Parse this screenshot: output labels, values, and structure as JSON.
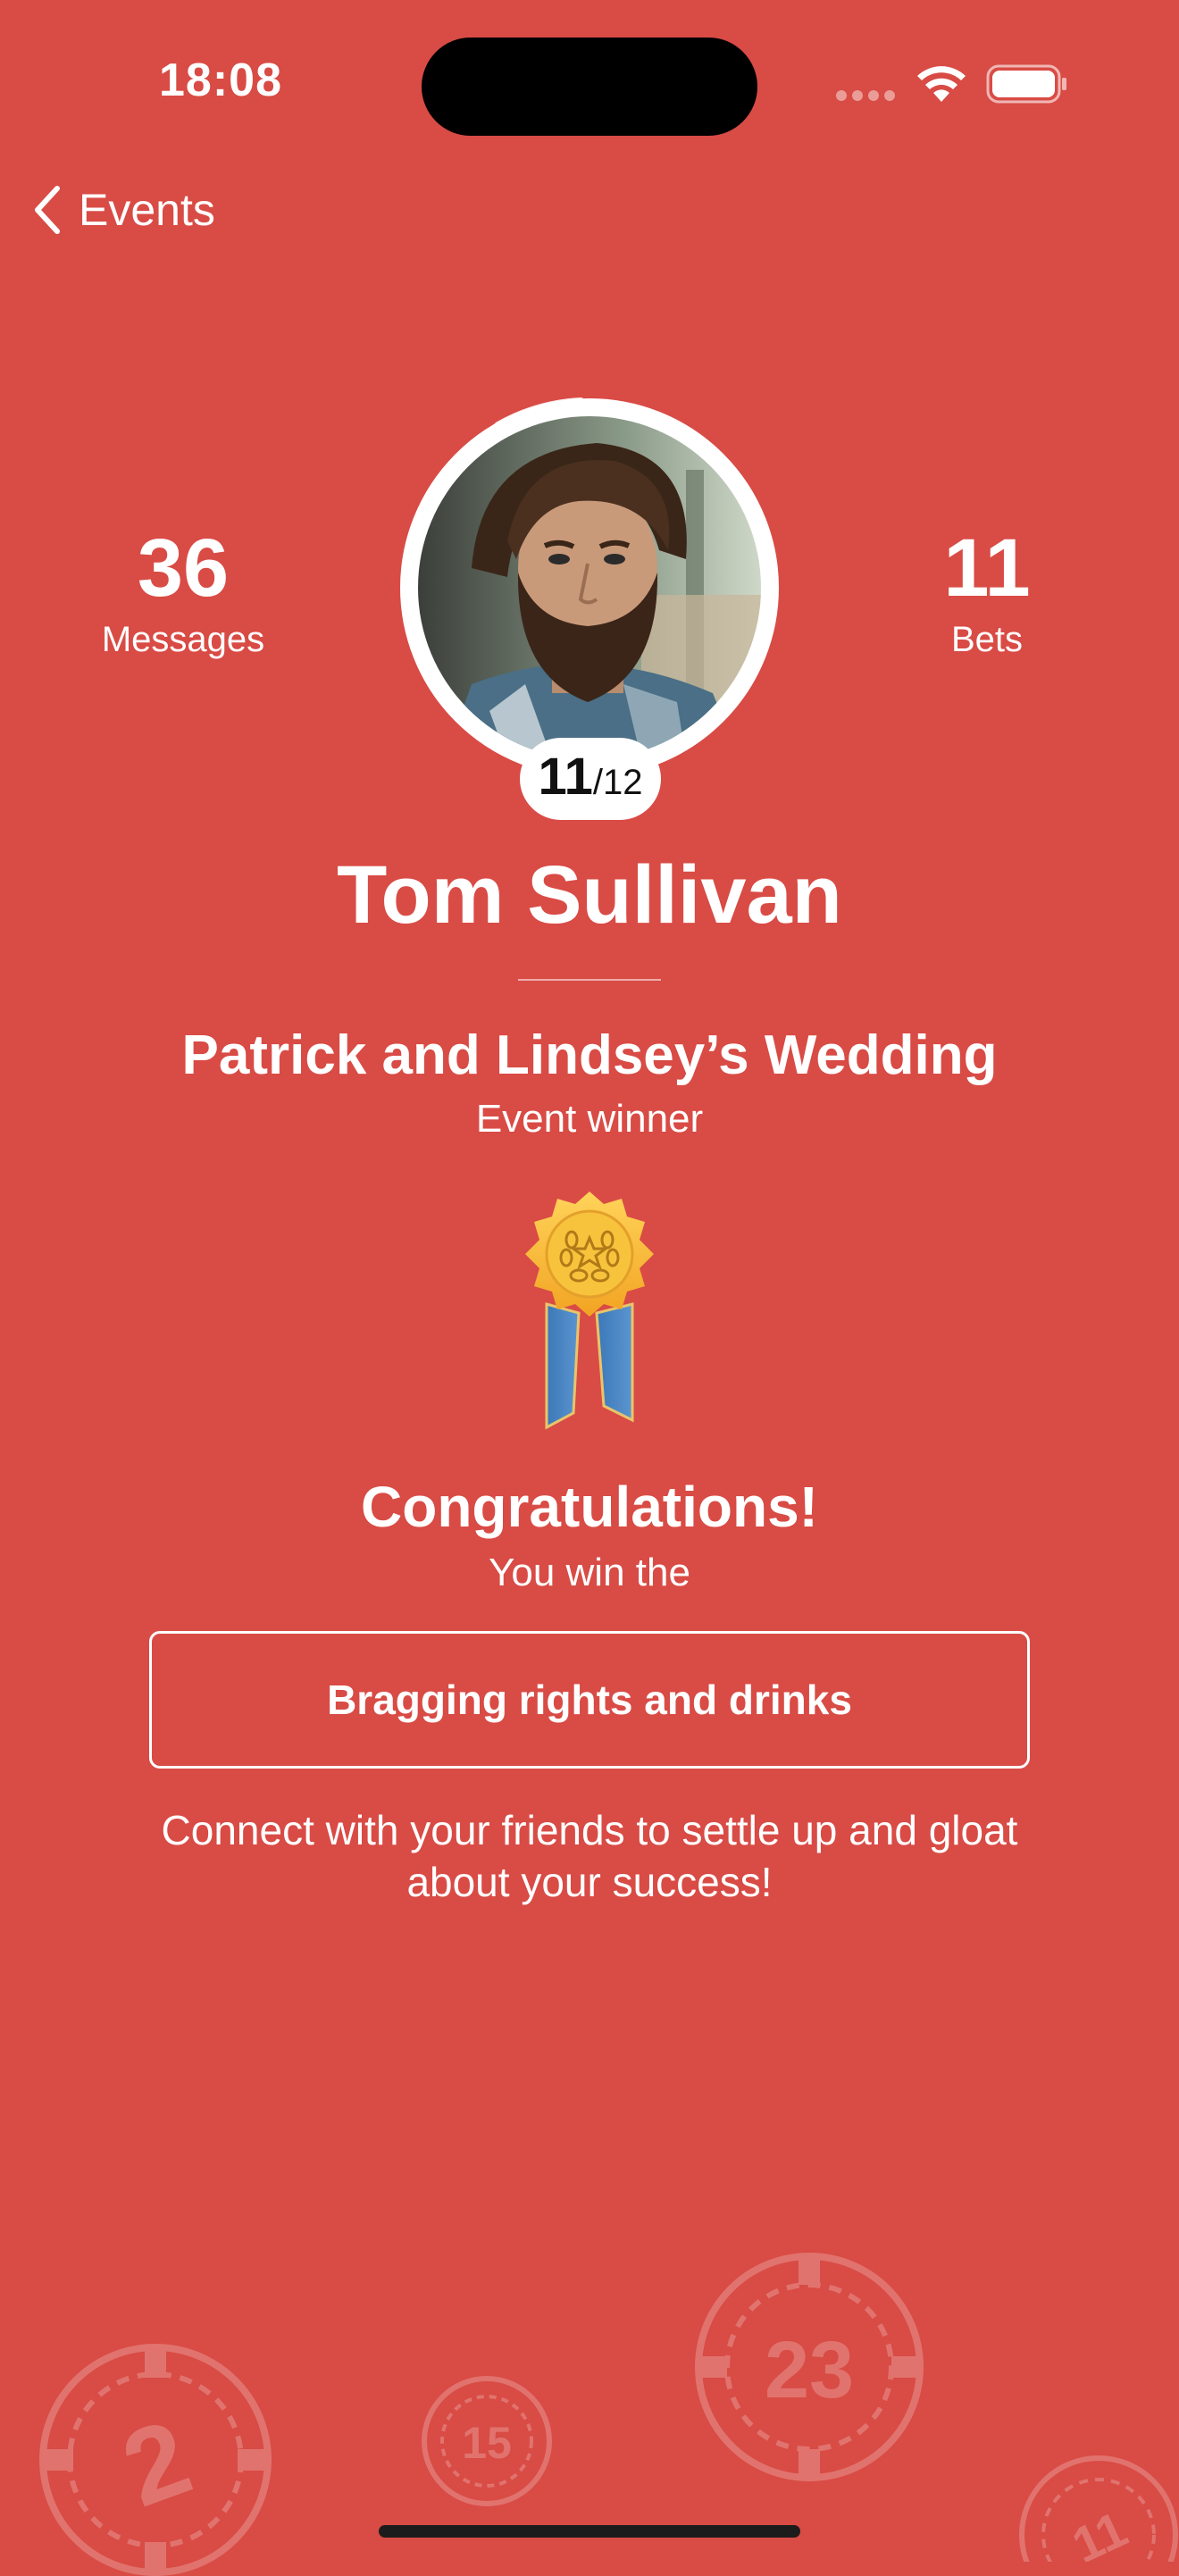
{
  "status_bar": {
    "time": "18:08"
  },
  "nav": {
    "back_label": "Events"
  },
  "profile": {
    "messages_count": "36",
    "messages_label": "Messages",
    "bets_count": "11",
    "bets_label": "Bets",
    "score_correct": "11",
    "score_total": "/12",
    "name": "Tom Sullivan"
  },
  "event": {
    "title": "Patrick and Lindsey’s Wedding",
    "subtitle": "Event winner"
  },
  "award": {
    "congrats": "Congratulations!",
    "win_text": "You win the",
    "prize": "Bragging rights and drinks",
    "connect_text": "Connect with your friends to settle up and gloat about your success!"
  },
  "decor": {
    "chip_numbers": [
      "2",
      "15",
      "23",
      "11"
    ]
  },
  "colors": {
    "background": "#D94B45",
    "text": "#FFFFFF",
    "medal_gold": "#F5B82A",
    "ribbon_blue": "#3F7FC0"
  }
}
